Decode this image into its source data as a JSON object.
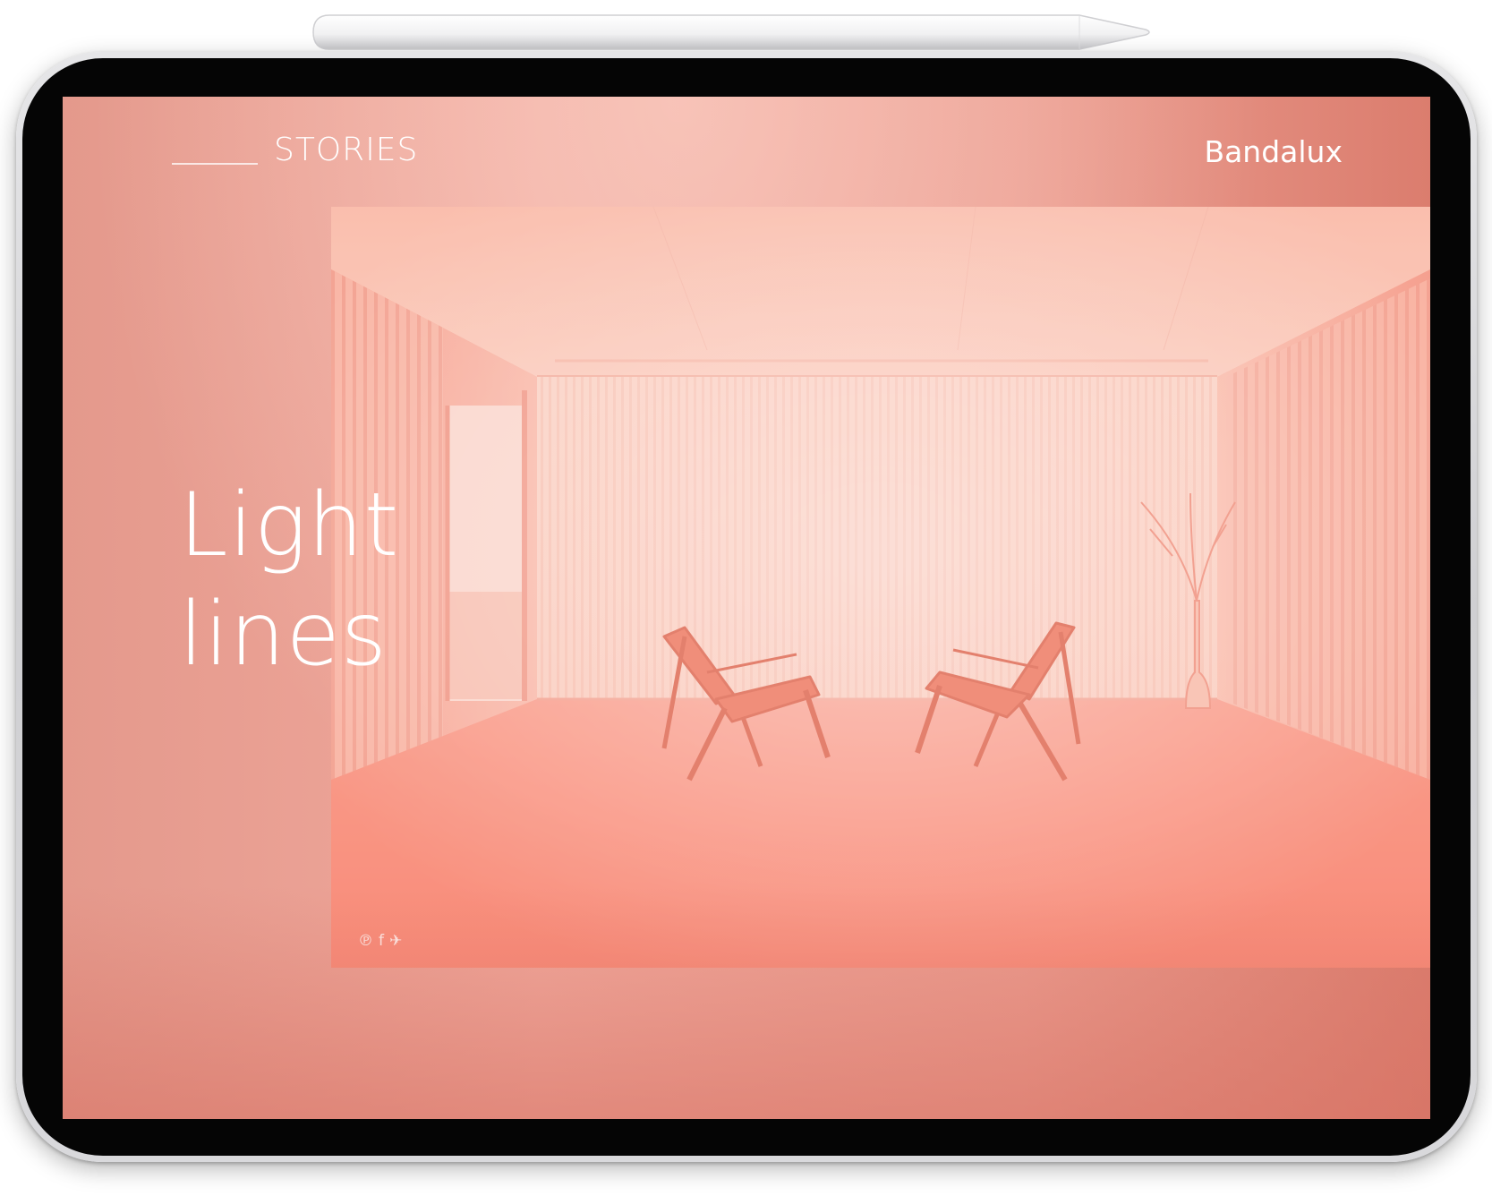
{
  "nav": {
    "section_label": "STORIES",
    "brand": "Bandalux"
  },
  "hero": {
    "headline_line1": "Light",
    "headline_line2": "lines",
    "image_subject": "room with vertical blinds and two lounge chairs"
  },
  "social": {
    "icons": [
      "pinterest-icon",
      "facebook-icon",
      "twitter-icon"
    ],
    "pinterest_glyph": "℗",
    "facebook_glyph": "f",
    "twitter_glyph": "✈"
  },
  "colors": {
    "accent_coral": "#e4998c",
    "hero_tint": "#f8b3a4",
    "text": "#ffffff",
    "bezel": "#050505",
    "device_frame": "#d9d9dc"
  }
}
